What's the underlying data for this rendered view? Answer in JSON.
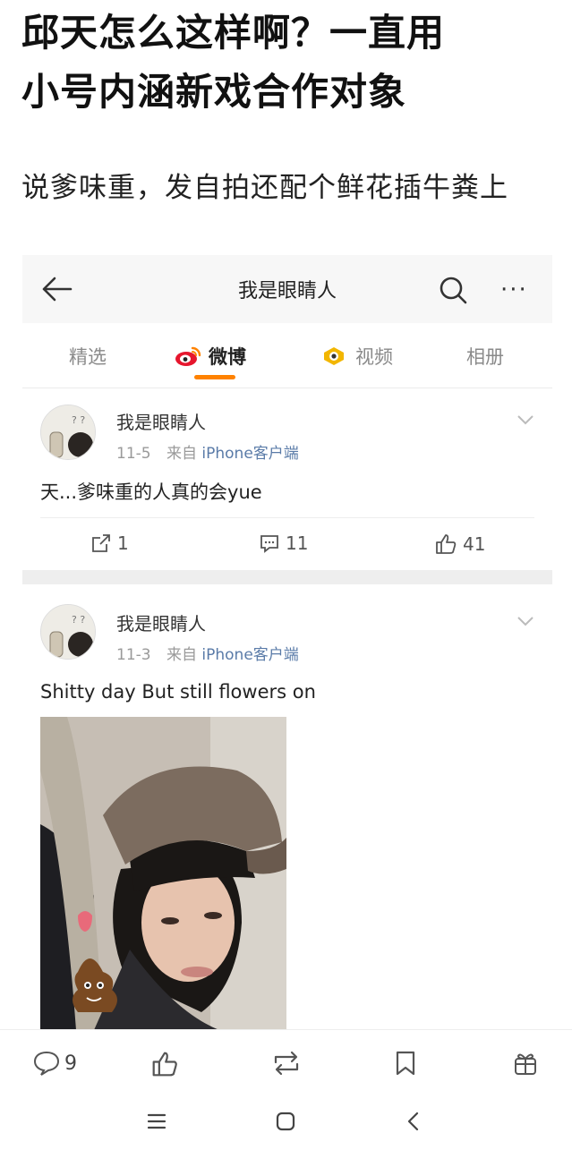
{
  "headline": {
    "line1": "邱天怎么这样啊？一直用",
    "line2": "小号内涵新戏合作对象",
    "sub": "说爹味重，发自拍还配个鲜花插牛粪上"
  },
  "profile_bar": {
    "name": "我是眼睛人",
    "more": "···"
  },
  "tabs": [
    {
      "label": "精选"
    },
    {
      "label": "微博"
    },
    {
      "label": "视频"
    },
    {
      "label": "相册"
    }
  ],
  "posts": [
    {
      "user": "我是眼睛人",
      "date": "11-5",
      "source_prefix": "来自",
      "source": "iPhone客户端",
      "text": "天...爹味重的人真的会yue",
      "reposts": "1",
      "comments": "11",
      "likes": "41"
    },
    {
      "user": "我是眼睛人",
      "date": "11-3",
      "source_prefix": "来自",
      "source": "iPhone客户端",
      "text": "Shitty day But still flowers on"
    }
  ],
  "bottom_bar": {
    "comments": "9"
  },
  "colors": {
    "accent": "#ff8200",
    "source_link": "#5a7ba8",
    "muted": "#9a9a9a"
  }
}
